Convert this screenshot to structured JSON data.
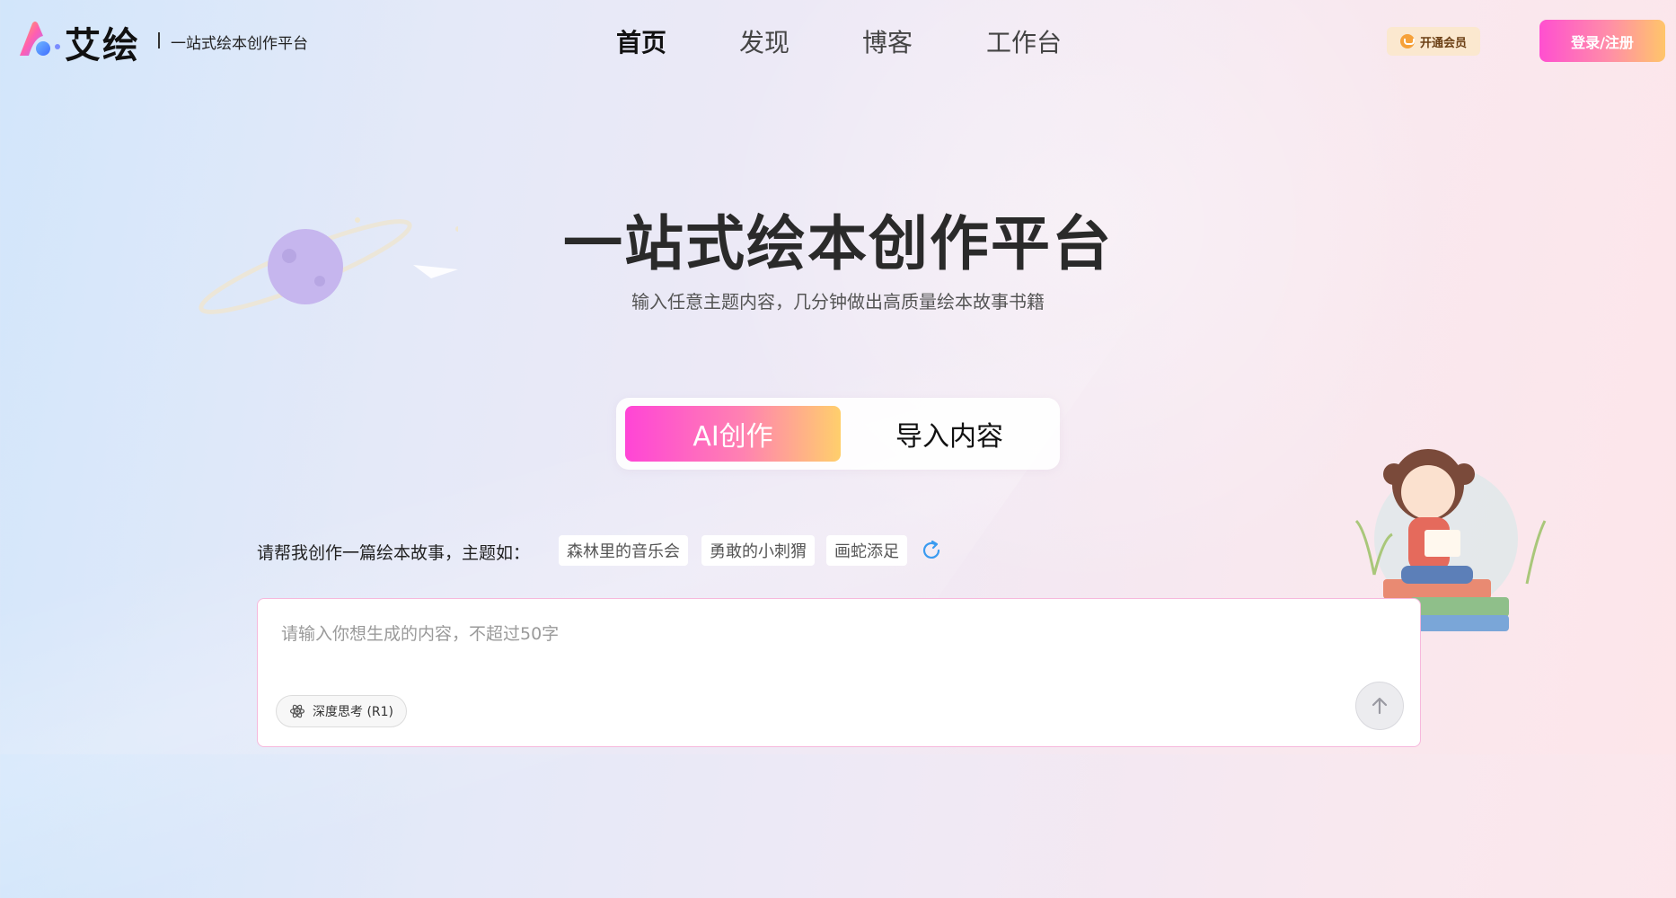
{
  "header": {
    "brand": "艾绘",
    "brand_subtitle": "一站式绘本创作平台",
    "nav": [
      "首页",
      "发现",
      "博客",
      "工作台"
    ],
    "active_nav": "首页",
    "vip_label": "开通会员",
    "login_label": "登录/注册"
  },
  "hero": {
    "title": "一站式绘本创作平台",
    "subtitle": "输入任意主题内容，几分钟做出高质量绘本故事书籍"
  },
  "modes": {
    "ai": "AI创作",
    "import": "导入内容",
    "selected": "AI创作"
  },
  "prompt": {
    "label": "请帮我创作一篇绘本故事，主题如：",
    "suggestions": [
      "森林里的音乐会",
      "勇敢的小刺猬",
      "画蛇添足"
    ]
  },
  "input": {
    "value": "",
    "placeholder": "请输入你想生成的内容，不超过50字",
    "deep_think_label": "深度思考 (R1)"
  },
  "colors": {
    "accent_gradient_start": "#ff45d6",
    "accent_gradient_end": "#ffcf6c",
    "input_border": "#f6b8dc"
  },
  "icons": [
    "logo-icon",
    "vip-icon",
    "refresh-icon",
    "atom-icon",
    "arrow-up-icon"
  ]
}
